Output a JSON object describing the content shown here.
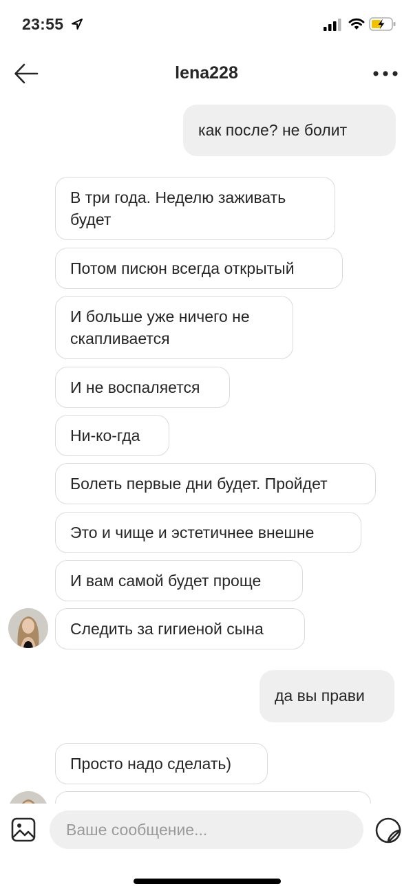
{
  "status_bar": {
    "time": "23:55"
  },
  "header": {
    "username": "lena228"
  },
  "messages": {
    "out_1": "как после?  не болит",
    "in_1": "В три года. Неделю заживать будет",
    "in_2": "Потом писюн всегда открытый",
    "in_3": "И больше уже ничего не скапливается",
    "in_4": "И не воспаляется",
    "in_5": "Ни-ко-гда",
    "in_6": "Болеть первые дни будет. Пройдет",
    "in_7": "Это и чище и эстетичнее внешне",
    "in_8": "И вам самой будет проще",
    "in_9": "Следить за гигиеной сына",
    "out_2": "да вы прави",
    "in_10": "Просто надо сделать)"
  },
  "composer": {
    "placeholder": "Ваше сообщение..."
  }
}
